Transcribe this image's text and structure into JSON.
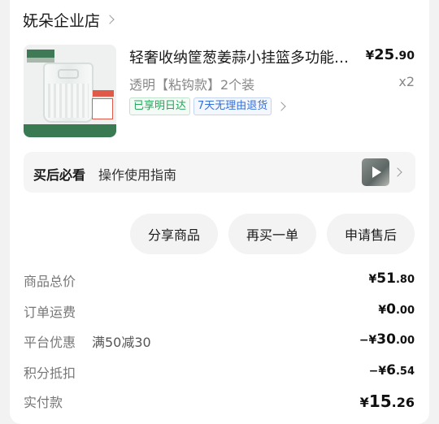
{
  "shop": {
    "name": "妩朵企业店"
  },
  "product": {
    "title": "轻奢收纳筐葱姜蒜小挂篮多功能厨房收纳",
    "price": {
      "symbol": "¥",
      "int": "25",
      "dec": ".90"
    },
    "variant": "透明【粘钩款】2个装",
    "quantity": "x2",
    "badges": [
      "已享明日达",
      "7天无理由退货"
    ]
  },
  "guide": {
    "key": "买后必看",
    "text": "操作使用指南"
  },
  "actions": {
    "share": "分享商品",
    "rebuy": "再买一单",
    "after_sale": "申请售后"
  },
  "summary": {
    "goods_total": {
      "label": "商品总价",
      "symbol": "¥",
      "int": "51",
      "dec": ".80"
    },
    "shipping": {
      "label": "订单运费",
      "symbol": "¥",
      "int": "0",
      "dec": ".00"
    },
    "platform_discount": {
      "label": "平台优惠",
      "detail": "满50减30",
      "symbol": "−¥",
      "int": "30",
      "dec": ".00"
    },
    "points": {
      "label": "积分抵扣",
      "symbol": "−¥",
      "int": "6",
      "dec": ".54"
    },
    "paid": {
      "label": "实付款",
      "symbol": "¥",
      "int": "15",
      "dec": ".26"
    }
  }
}
